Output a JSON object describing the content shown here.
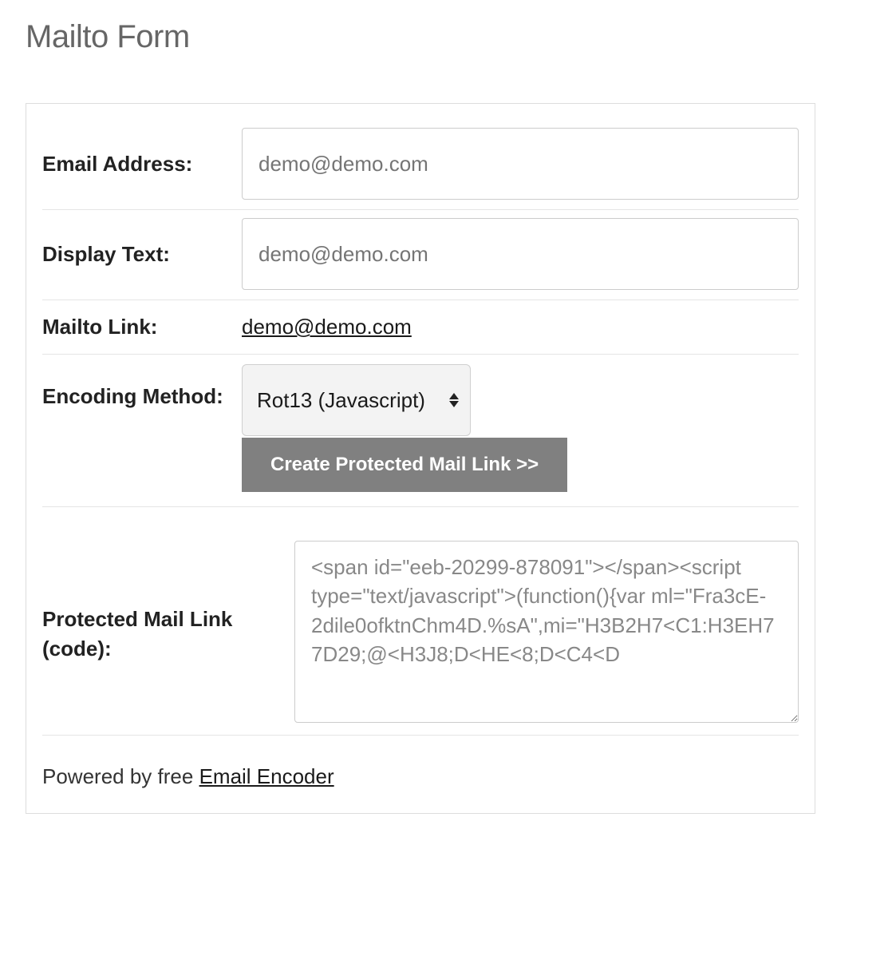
{
  "page": {
    "title": "Mailto Form"
  },
  "form": {
    "email": {
      "label": "Email Address:",
      "placeholder": "demo@demo.com",
      "value": ""
    },
    "displayText": {
      "label": "Display Text:",
      "placeholder": "demo@demo.com",
      "value": ""
    },
    "mailtoLink": {
      "label": "Mailto Link:",
      "text": "demo@demo.com",
      "href": "mailto:demo@demo.com"
    },
    "encoding": {
      "label": "Encoding Method:",
      "selected": "Rot13 (Javascript)",
      "button": "Create Protected Mail Link >>"
    },
    "protectedCode": {
      "label": "Protected Mail Link (code):",
      "value": "<span id=\"eeb-20299-878091\"></span><script type=\"text/javascript\">(function(){var ml=\"Fra3cE-2dile0ofktnChm4D.%sA\",mi=\"H3B2H7<C1:H3EH77D29;@<H3J8;D<HE<8;D<C4<D"
    }
  },
  "footer": {
    "prefix": "Powered by free ",
    "linkText": "Email Encoder"
  }
}
